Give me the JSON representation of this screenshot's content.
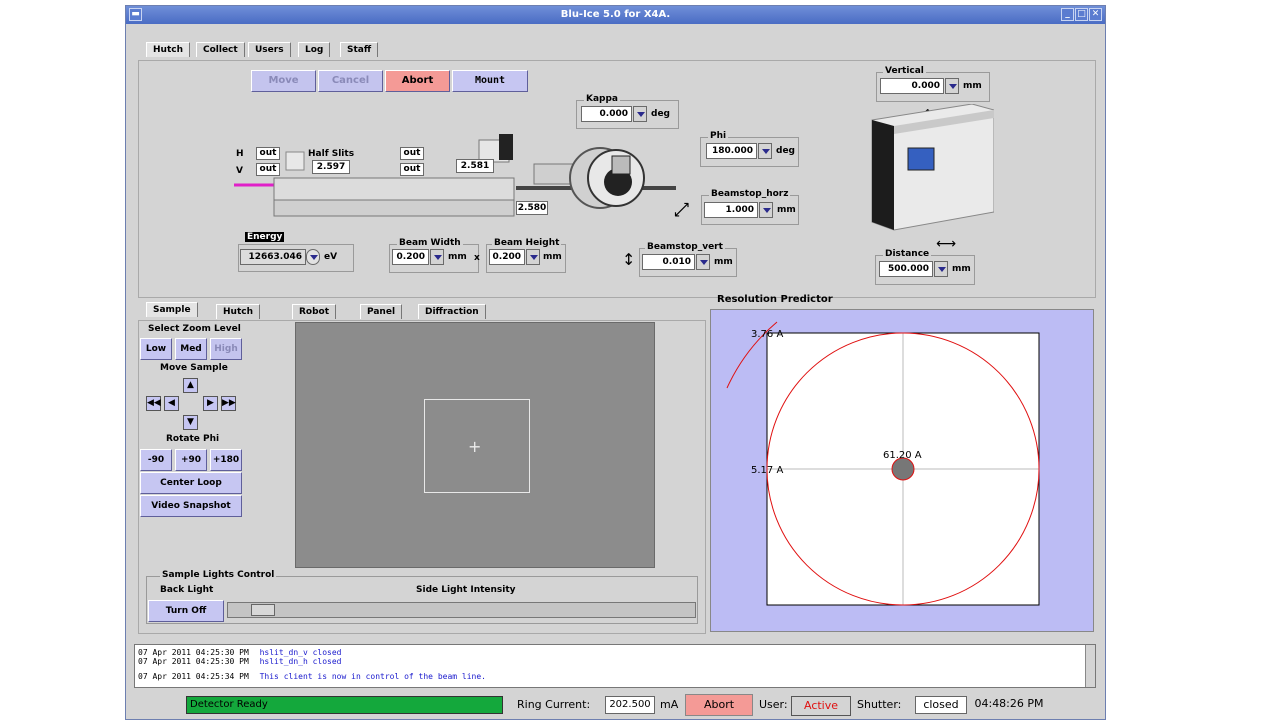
{
  "window": {
    "title": "Blu-Ice 5.0 for X4A."
  },
  "main_tabs": [
    "Hutch",
    "Collect",
    "Users",
    "Log",
    "Staff"
  ],
  "motion_buttons": {
    "move": "Move",
    "cancel": "Cancel",
    "abort": "Abort",
    "mount": "Mount"
  },
  "slits": {
    "h_label": "H",
    "v_label": "V",
    "half_slits_label": "Half Slits",
    "h_left": "out",
    "v_left": "out",
    "h_right": "out",
    "v_right": "out",
    "gap1": "2.597",
    "gap2": "2.581",
    "gap3": "2.580"
  },
  "kappa": {
    "label": "Kappa",
    "value": "0.000",
    "unit": "deg"
  },
  "phi": {
    "label": "Phi",
    "value": "180.000",
    "unit": "deg"
  },
  "beamstop_horz": {
    "label": "Beamstop_horz",
    "value": "1.000",
    "unit": "mm"
  },
  "beamstop_vert": {
    "label": "Beamstop_vert",
    "value": "0.010",
    "unit": "mm"
  },
  "vertical": {
    "label": "Vertical",
    "value": "0.000",
    "unit": "mm"
  },
  "distance": {
    "label": "Distance",
    "value": "500.000",
    "unit": "mm"
  },
  "energy": {
    "label": "Energy",
    "value": "12663.046",
    "unit": "eV"
  },
  "beam_width": {
    "label": "Beam Width",
    "value": "0.200",
    "unit": "mm"
  },
  "beam_height": {
    "label": "Beam Height",
    "value": "0.200",
    "unit": "mm"
  },
  "beam_times": "x",
  "sub_tabs": [
    "Sample",
    "Hutch",
    "Robot",
    "Panel",
    "Diffraction"
  ],
  "sample": {
    "zoom_label": "Select Zoom Level",
    "zoom": [
      "Low",
      "Med",
      "High"
    ],
    "move_label": "Move Sample",
    "rotate_label": "Rotate Phi",
    "rotate": [
      "-90",
      "+90",
      "+180"
    ],
    "center_loop": "Center Loop",
    "video_snapshot": "Video Snapshot",
    "lights_label": "Sample Lights Control",
    "back_light": "Back Light",
    "side_light": "Side Light Intensity",
    "turn_off": "Turn Off",
    "side_light_level": 0.05
  },
  "resolution": {
    "title": "Resolution Predictor",
    "outer_label": "3.76 A",
    "edge_label": "5.17 A",
    "center_label": "61.20 A"
  },
  "log": [
    {
      "time": "07 Apr 2011 04:25:30 PM",
      "msg": "hslit_dn_v closed"
    },
    {
      "time": "07 Apr 2011 04:25:30 PM",
      "msg": "hslit_dn_h closed"
    },
    {
      "time": "07 Apr 2011 04:25:34 PM",
      "msg": "This client is now in control of the beam line."
    }
  ],
  "status": {
    "detector": "Detector Ready",
    "ring_label": "Ring Current:",
    "ring_value": "202.500",
    "ring_unit": "mA",
    "abort": "Abort",
    "user_label": "User:",
    "user_value": "Active",
    "shutter_label": "Shutter:",
    "shutter_value": "closed",
    "time": "04:48:26 PM"
  },
  "colors": {
    "button": "#c6c6f2",
    "abort": "#f49a96",
    "detector_ok": "#14a83c",
    "res_bg": "#bcbcf4",
    "circle": "#e01010"
  }
}
